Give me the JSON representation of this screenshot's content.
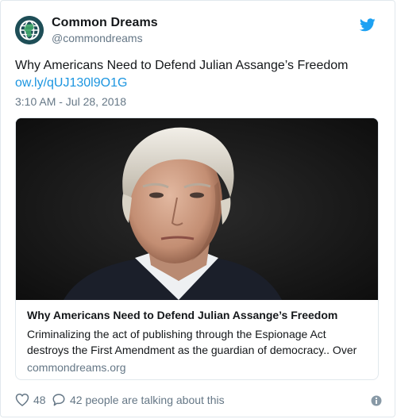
{
  "account": {
    "name": "Common Dreams",
    "handle": "@commondreams"
  },
  "tweet": {
    "text": "Why Americans Need to Defend Julian Assange’s Freedom",
    "link": "ow.ly/qUJ130l9O1G",
    "timestamp": "3:10 AM - Jul 28, 2018"
  },
  "card": {
    "title": "Why Americans Need to Defend Julian Assange’s Freedom",
    "description": "Criminalizing the act of publishing through the Espionage Act destroys the First Amendment as the guardian of democracy.. Over",
    "domain": "commondreams.org"
  },
  "actions": {
    "likes": "48",
    "conversation": "42 people are talking about this"
  },
  "icons": {
    "avatar": "globe-icon",
    "platform": "twitter-bird-icon",
    "like": "heart-icon",
    "reply": "speech-bubble-icon",
    "info": "info-icon"
  },
  "colors": {
    "link": "#1b95e0",
    "secondary_text": "#657786",
    "border": "#e1e8ed",
    "avatar_bg": "#1e4e57"
  }
}
